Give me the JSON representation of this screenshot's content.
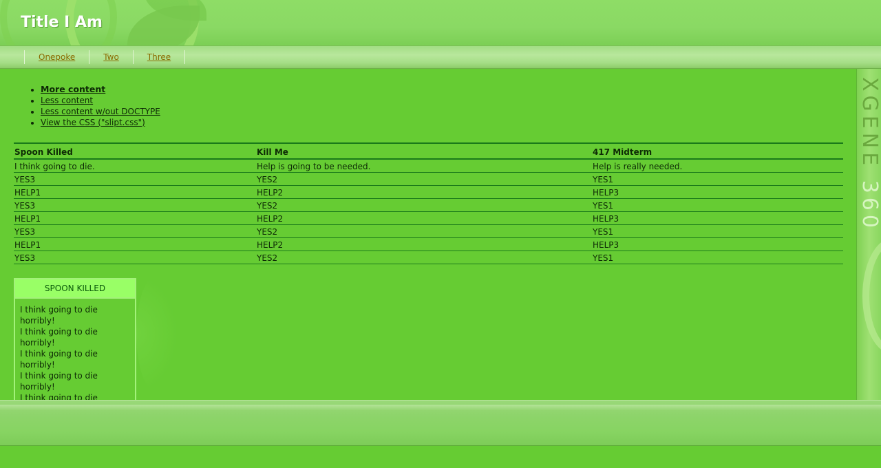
{
  "header": {
    "title": "Title I Am"
  },
  "nav": {
    "items": [
      "Onepoke",
      "Two",
      "Three"
    ]
  },
  "sidebar": {
    "brand_a": "XGENE",
    "brand_b": " 360"
  },
  "links": [
    "More content",
    "Less content",
    "Less content w/out DOCTYPE",
    "View the CSS (\"slipt.css\")"
  ],
  "table": {
    "headers": [
      "Spoon Killed",
      "Kill Me",
      "417 Midterm"
    ],
    "rows": [
      [
        "I think going to die.",
        "Help is going to be needed.",
        "Help is really needed."
      ],
      [
        "YES3",
        "YES2",
        "YES1"
      ],
      [
        "HELP1",
        "HELP2",
        "HELP3"
      ],
      [
        "YES3",
        "YES2",
        "YES1"
      ],
      [
        "HELP1",
        "HELP2",
        "HELP3"
      ],
      [
        "YES3",
        "YES2",
        "YES1"
      ],
      [
        "HELP1",
        "HELP2",
        "HELP3"
      ],
      [
        "YES3",
        "YES2",
        "YES1"
      ]
    ]
  },
  "box": {
    "title": "SPOON KILLED",
    "lines": [
      "I think going to die horribly!",
      "I think going to die horribly!",
      "I think going to die horribly!",
      "I think going to die horribly!",
      "I think going to die horribly!"
    ]
  }
}
